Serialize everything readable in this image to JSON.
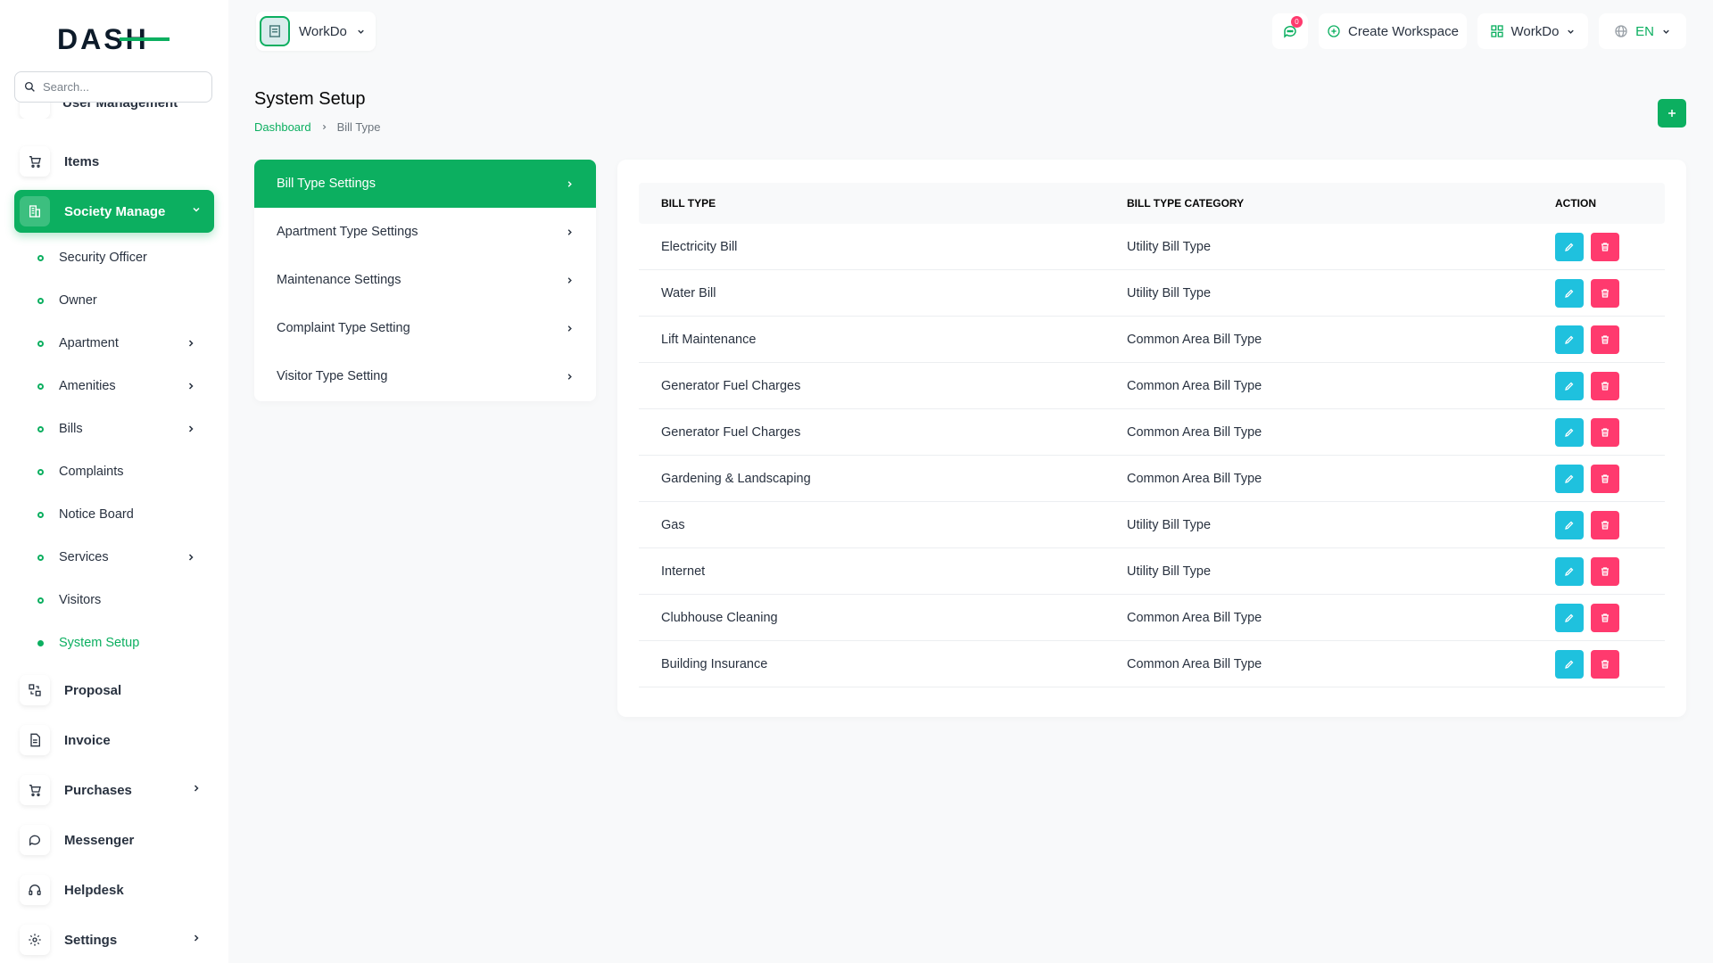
{
  "brand": {
    "logo_text": "DASH"
  },
  "search": {
    "placeholder": "Search..."
  },
  "sidebar": {
    "partial_item": "User Management",
    "items": [
      {
        "label": "Items",
        "icon": "cart-icon"
      },
      {
        "label": "Society Manage",
        "icon": "building-icon",
        "active": true
      },
      {
        "label": "Proposal",
        "icon": "proposal-icon"
      },
      {
        "label": "Invoice",
        "icon": "file-icon"
      },
      {
        "label": "Purchases",
        "icon": "cart-icon"
      },
      {
        "label": "Messenger",
        "icon": "chat-icon"
      },
      {
        "label": "Helpdesk",
        "icon": "headset-icon"
      },
      {
        "label": "Settings",
        "icon": "gear-icon"
      }
    ],
    "sub_items": [
      {
        "label": "Security Officer"
      },
      {
        "label": "Owner"
      },
      {
        "label": "Apartment"
      },
      {
        "label": "Amenities"
      },
      {
        "label": "Bills"
      },
      {
        "label": "Complaints"
      },
      {
        "label": "Notice Board"
      },
      {
        "label": "Services"
      },
      {
        "label": "Visitors"
      },
      {
        "label": "System Setup",
        "active": true
      }
    ]
  },
  "topbar": {
    "workspace_name": "WorkDo",
    "notification_count": "0",
    "create_workspace": "Create Workspace",
    "workspace_menu": "WorkDo",
    "language": "EN"
  },
  "page": {
    "title": "System Setup",
    "breadcrumb": {
      "home": "Dashboard",
      "current": "Bill Type"
    }
  },
  "settings_menu": [
    {
      "label": "Bill Type Settings",
      "active": true
    },
    {
      "label": "Apartment Type Settings"
    },
    {
      "label": "Maintenance Settings"
    },
    {
      "label": "Complaint Type Setting"
    },
    {
      "label": "Visitor Type Setting"
    }
  ],
  "table": {
    "headers": {
      "bill_type": "BILL TYPE",
      "category": "BILL TYPE CATEGORY",
      "action": "ACTION"
    },
    "rows": [
      {
        "bill_type": "Electricity Bill",
        "category": "Utility Bill Type"
      },
      {
        "bill_type": "Water Bill",
        "category": "Utility Bill Type"
      },
      {
        "bill_type": "Lift Maintenance",
        "category": "Common Area Bill Type"
      },
      {
        "bill_type": "Generator Fuel Charges",
        "category": "Common Area Bill Type"
      },
      {
        "bill_type": "Generator Fuel Charges",
        "category": "Common Area Bill Type"
      },
      {
        "bill_type": "Gardening & Landscaping",
        "category": "Common Area Bill Type"
      },
      {
        "bill_type": "Gas",
        "category": "Utility Bill Type"
      },
      {
        "bill_type": "Internet",
        "category": "Utility Bill Type"
      },
      {
        "bill_type": "Clubhouse Cleaning",
        "category": "Common Area Bill Type"
      },
      {
        "bill_type": "Building Insurance",
        "category": "Common Area Bill Type"
      }
    ]
  },
  "colors": {
    "accent": "#0caf60",
    "edit": "#1fc1de",
    "delete": "#ff3a6e"
  }
}
